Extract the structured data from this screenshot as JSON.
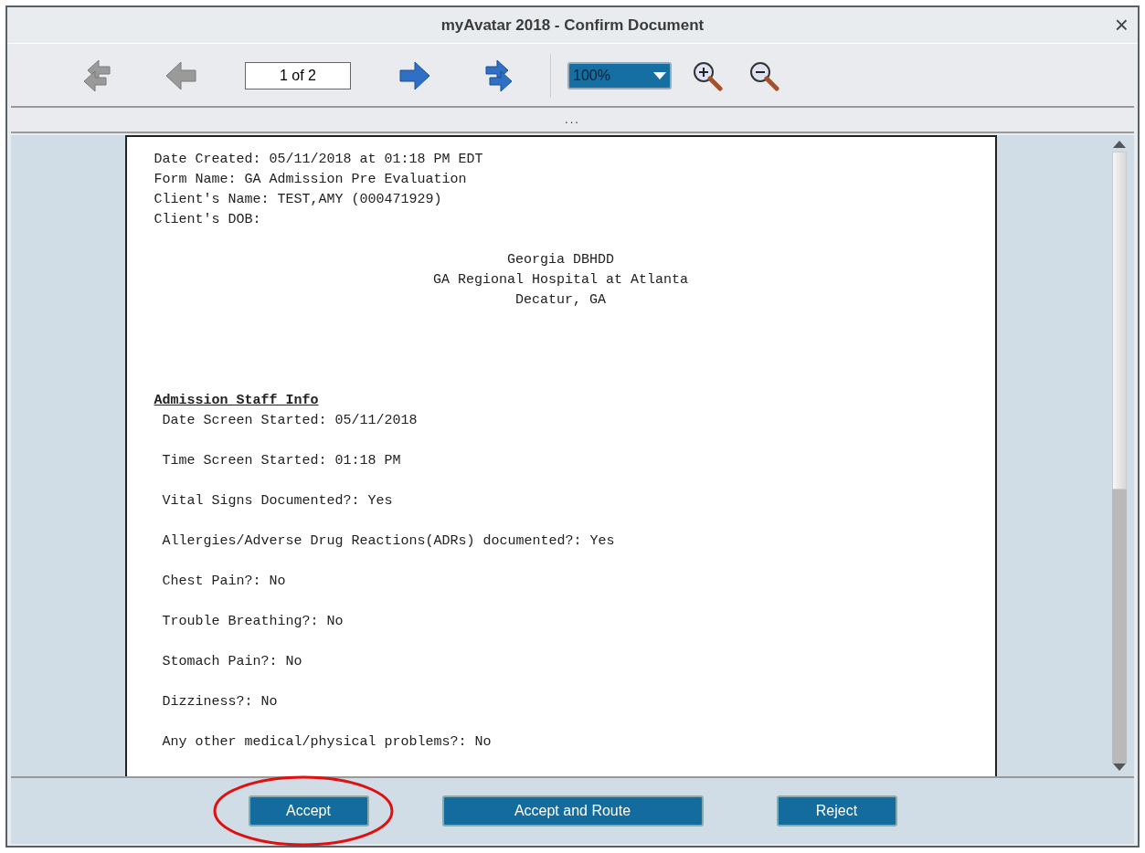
{
  "window": {
    "title": "myAvatar 2018 - Confirm Document",
    "close": "×"
  },
  "toolbar": {
    "nav": [
      {
        "kind": "first",
        "disabled": true
      },
      {
        "kind": "prev",
        "disabled": true
      },
      {
        "kind": "page",
        "value": "1 of 2"
      },
      {
        "kind": "next",
        "disabled": false
      },
      {
        "kind": "last",
        "disabled": false
      }
    ],
    "zoom": "100%"
  },
  "splitter": "...",
  "document": {
    "header_lines": [
      "Date Created: 05/11/2018 at 01:18 PM EDT",
      "Form Name: GA Admission Pre Evaluation",
      "Client's Name: TEST,AMY (000471929)",
      "Client's DOB:"
    ],
    "center_lines": [
      "Georgia DBHDD",
      "GA Regional Hospital at Atlanta",
      "Decatur, GA"
    ],
    "section": "Admission Staff Info",
    "fields": [
      "Date Screen Started: 05/11/2018",
      "Time Screen Started: 01:18 PM",
      "Vital Signs Documented?: Yes",
      "Allergies/Adverse Drug Reactions(ADRs) documented?: Yes",
      "Chest Pain?: No",
      "Trouble Breathing?: No",
      "Stomach Pain?: No",
      "Dizziness?: No",
      "Any other medical/physical problems?: No"
    ]
  },
  "buttons": [
    {
      "label": "Accept",
      "circled": true
    },
    {
      "label": "Accept and Route",
      "circled": false
    },
    {
      "label": "Reject",
      "circled": false
    }
  ]
}
